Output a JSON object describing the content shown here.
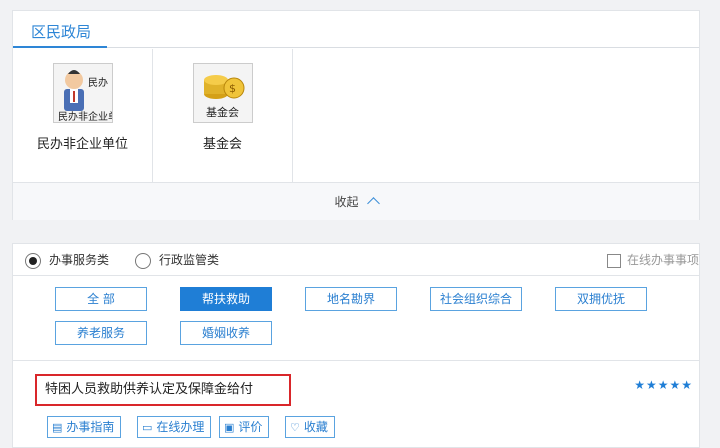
{
  "header": {
    "tab_label": "区民政局"
  },
  "tiles": [
    {
      "label": "民办非企业单位",
      "icon": "person-with-org-icon",
      "icon_text": "民办非企业单位"
    },
    {
      "label": "基金会",
      "icon": "gold-coins-icon",
      "icon_text": "基金会"
    }
  ],
  "collapse": {
    "label": "收起"
  },
  "filters": {
    "radio_service": "办事服务类",
    "radio_admin": "行政监管类",
    "online_only": "在线办事事项"
  },
  "categories": [
    "全 部",
    "帮扶救助",
    "地名勘界",
    "社会组织综合",
    "双拥优抚",
    "养老服务",
    "婚姻收养"
  ],
  "active_category": "帮扶救助",
  "item": {
    "title": "特困人员救助供养认定及保障金给付",
    "stars": "★★★★★",
    "actions": {
      "guide": "办事指南",
      "online": "在线办理",
      "rate": "评价",
      "favorite": "收藏"
    }
  },
  "colors": {
    "accent": "#1f7ed6",
    "highlight_border": "#d9262a"
  }
}
